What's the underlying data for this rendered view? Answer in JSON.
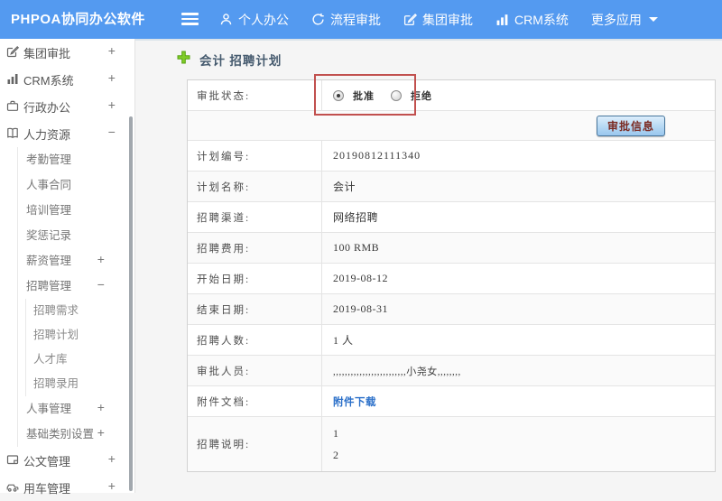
{
  "theme": {
    "topbar_bg": "#549af0",
    "link_color": "#2a6fc9",
    "annotation_box_color": "#c1504e",
    "button_text_color": "#7b2a22"
  },
  "topbar": {
    "brand": "PHPOA协同办公软件",
    "items": [
      {
        "label": "个人办公",
        "icon": "person-icon"
      },
      {
        "label": "流程审批",
        "icon": "process-icon"
      },
      {
        "label": "集团审批",
        "icon": "edit-square-icon"
      },
      {
        "label": "CRM系统",
        "icon": "bar-chart-icon"
      },
      {
        "label": "更多应用",
        "icon": "caret-down-icon"
      }
    ]
  },
  "sidebar": {
    "items": [
      {
        "label": "集团审批",
        "toggle": "+"
      },
      {
        "label": "CRM系统",
        "toggle": "+"
      },
      {
        "label": "行政办公",
        "toggle": "+"
      },
      {
        "label": "人力资源",
        "toggle": "−"
      },
      {
        "label": "考勤管理"
      },
      {
        "label": "人事合同"
      },
      {
        "label": "培训管理"
      },
      {
        "label": "奖惩记录"
      },
      {
        "label": "薪资管理",
        "toggle": "+"
      },
      {
        "label": "招聘管理",
        "toggle": "−"
      },
      {
        "label": "招聘需求"
      },
      {
        "label": "招聘计划"
      },
      {
        "label": "人才库"
      },
      {
        "label": "招聘录用"
      },
      {
        "label": "人事管理",
        "toggle": "+"
      },
      {
        "label": "基础类别设置",
        "toggle": "+"
      },
      {
        "label": "公文管理",
        "toggle": "+"
      },
      {
        "label": "用车管理",
        "toggle": "+"
      }
    ]
  },
  "main": {
    "title": "会计 招聘计划",
    "approval": {
      "label": "审批状态:",
      "options": [
        {
          "label": "批准",
          "selected": true
        },
        {
          "label": "拒绝",
          "selected": false
        }
      ]
    },
    "approve_info_button": "审批信息",
    "rows": [
      {
        "label": "计划编号:",
        "value": "20190812111340"
      },
      {
        "label": "计划名称:",
        "value": "会计"
      },
      {
        "label": "招聘渠道:",
        "value": "网络招聘"
      },
      {
        "label": "招聘费用:",
        "value": "100 RMB"
      },
      {
        "label": "开始日期:",
        "value": "2019-08-12"
      },
      {
        "label": "结束日期:",
        "value": "2019-08-31"
      },
      {
        "label": "招聘人数:",
        "value": "1 人"
      },
      {
        "label": "审批人员:",
        "value": ",,,,,,,,,,,,,,,,,,,,,,,,,小尧女,,,,,,,,"
      },
      {
        "label": "附件文档:",
        "value": "附件下载"
      },
      {
        "label": "招聘说明:",
        "line1": "1",
        "line2": "2"
      }
    ]
  }
}
